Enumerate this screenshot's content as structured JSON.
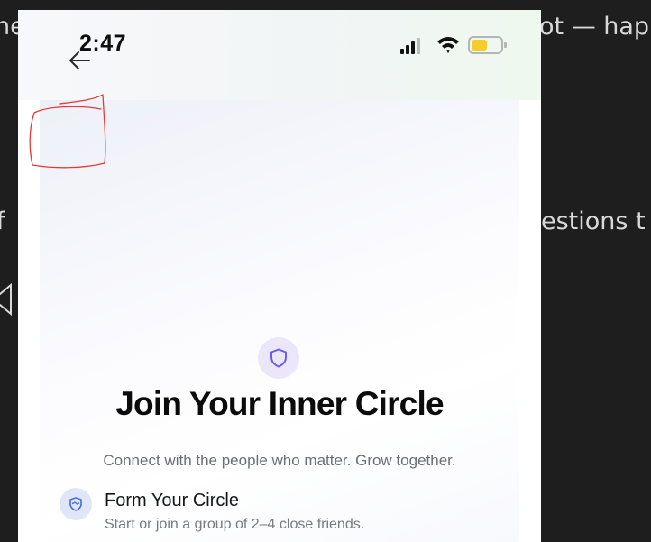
{
  "background": {
    "text_left_1": "he",
    "text_right_1": "ot — happ",
    "text_left_2": "f",
    "text_right_2": "estions t",
    "icon": "speaker-icon"
  },
  "status_bar": {
    "time": "2:47",
    "icons": [
      "back-arrow-icon",
      "signal-icon",
      "wifi-icon",
      "battery-icon"
    ]
  },
  "hero": {
    "icon": "shield-icon",
    "title": "Join Your Inner Circle",
    "subtitle": "Connect with the people who matter. Grow together."
  },
  "features": [
    {
      "icon": "handshake-icon",
      "title": "Form Your Circle",
      "description": "Start or join a group of 2–4 close friends."
    }
  ],
  "colors": {
    "accent": "#6c5ce7",
    "badge_bg": "#ebe7f9",
    "feature_icon_bg": "#dfe6f7",
    "annotation": "#e53935",
    "battery": "#f5cd2a"
  }
}
